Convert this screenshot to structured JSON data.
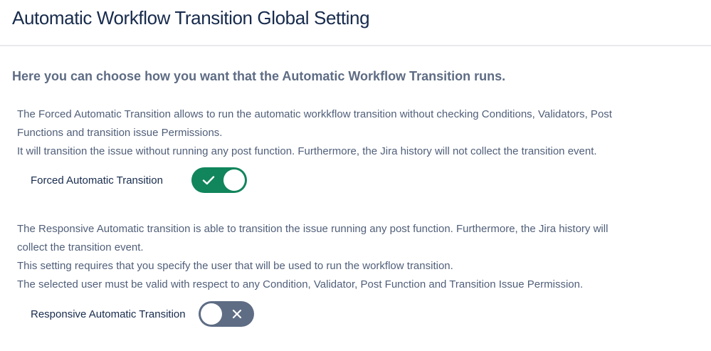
{
  "header": {
    "title": "Automatic Workflow Transition Global Setting"
  },
  "intro": "Here you can choose how you want that the Automatic Workflow Transition runs.",
  "forced": {
    "description_lines": [
      "The Forced Automatic Transition allows to run the automatic workkflow transition without checking Conditions, Validators, Post",
      "Functions and transition issue Permissions.",
      "It will transition the issue without running any post function. Furthermore, the Jira history will not collect the transition event."
    ],
    "label": "Forced Automatic Transition",
    "enabled": true,
    "toggle_icon": "check-icon",
    "toggle_color": "#11855c"
  },
  "responsive": {
    "description_lines": [
      "The Responsive Automatic transition is able to transition the issue running any post function. Furthermore, the Jira history will",
      "collect the transition event.",
      "This setting requires that you specify the user that will be used to run the workflow transition.",
      "The selected user must be valid with respect to any Condition, Validator, Post Function and Transition Issue Permission."
    ],
    "label": "Responsive Automatic Transition",
    "enabled": false,
    "toggle_icon": "close-icon",
    "toggle_color": "#5e6c84"
  }
}
